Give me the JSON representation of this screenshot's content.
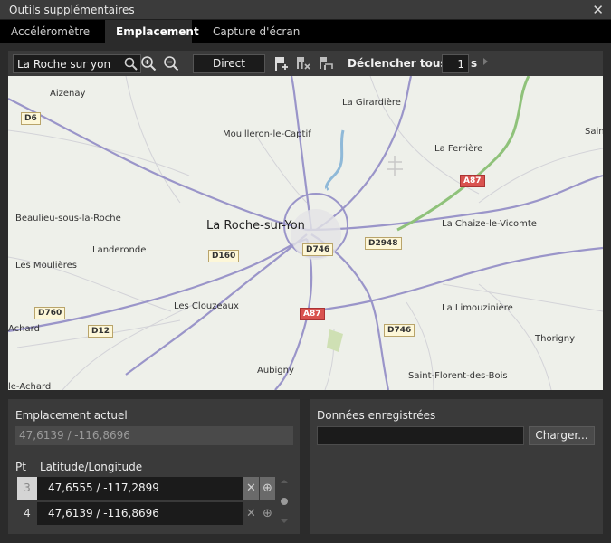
{
  "window": {
    "title": "Outils supplémentaires",
    "close_glyph": "✕"
  },
  "tabs": [
    {
      "label": "Accéléromètre",
      "active": false
    },
    {
      "label": "Emplacement",
      "active": true
    },
    {
      "label": "Capture d'écran",
      "active": false
    }
  ],
  "toolbar": {
    "search_value": "La Roche sur yon",
    "mode_label": "Direct",
    "trigger_label": "Déclencher tous les",
    "trigger_value": "1",
    "trigger_unit": "s",
    "icons": [
      "search-icon",
      "zoom-in-icon",
      "zoom-out-icon",
      "add-pin-icon",
      "clear-pins-icon",
      "route-icon",
      "play-icon"
    ]
  },
  "map": {
    "places": [
      "Aizenay",
      "La Girardière",
      "Mouilleron-le-Captif",
      "La Ferrière",
      "Saint",
      "Beaulieu-sous-la-Roche",
      "La Roche-sur-Yon",
      "La Chaize-le-Vicomte",
      "Landeronde",
      "Les Moulières",
      "Les Clouzeaux",
      "La Limouzinière",
      "Achard",
      "Thorigny",
      "Aubigny",
      "Saint-Florent-des-Bois",
      "le-Achard"
    ],
    "roads": [
      "D6",
      "A87",
      "D746",
      "D2948",
      "D160",
      "D760",
      "D12",
      "A87",
      "D746"
    ],
    "colors": {
      "background": "#eef0ea",
      "major_road": "#9a95c9",
      "motorway": "#8fc27a",
      "shield_red": "#d9534f",
      "shield_yellow": "#fdf7d8"
    }
  },
  "current_location": {
    "title": "Emplacement actuel",
    "value": "47,6139 / -116,8696"
  },
  "points": {
    "col_pt": "Pt",
    "col_latlng": "Latitude/Longitude",
    "rows": [
      {
        "num": "3",
        "value": "47,6555 / -117,2899"
      },
      {
        "num": "4",
        "value": "47,6139 / -116,8696"
      }
    ],
    "delete_glyph": "✕",
    "add_glyph": "⊕"
  },
  "saved_data": {
    "title": "Données enregistrées",
    "value": "",
    "load_label": "Charger..."
  }
}
